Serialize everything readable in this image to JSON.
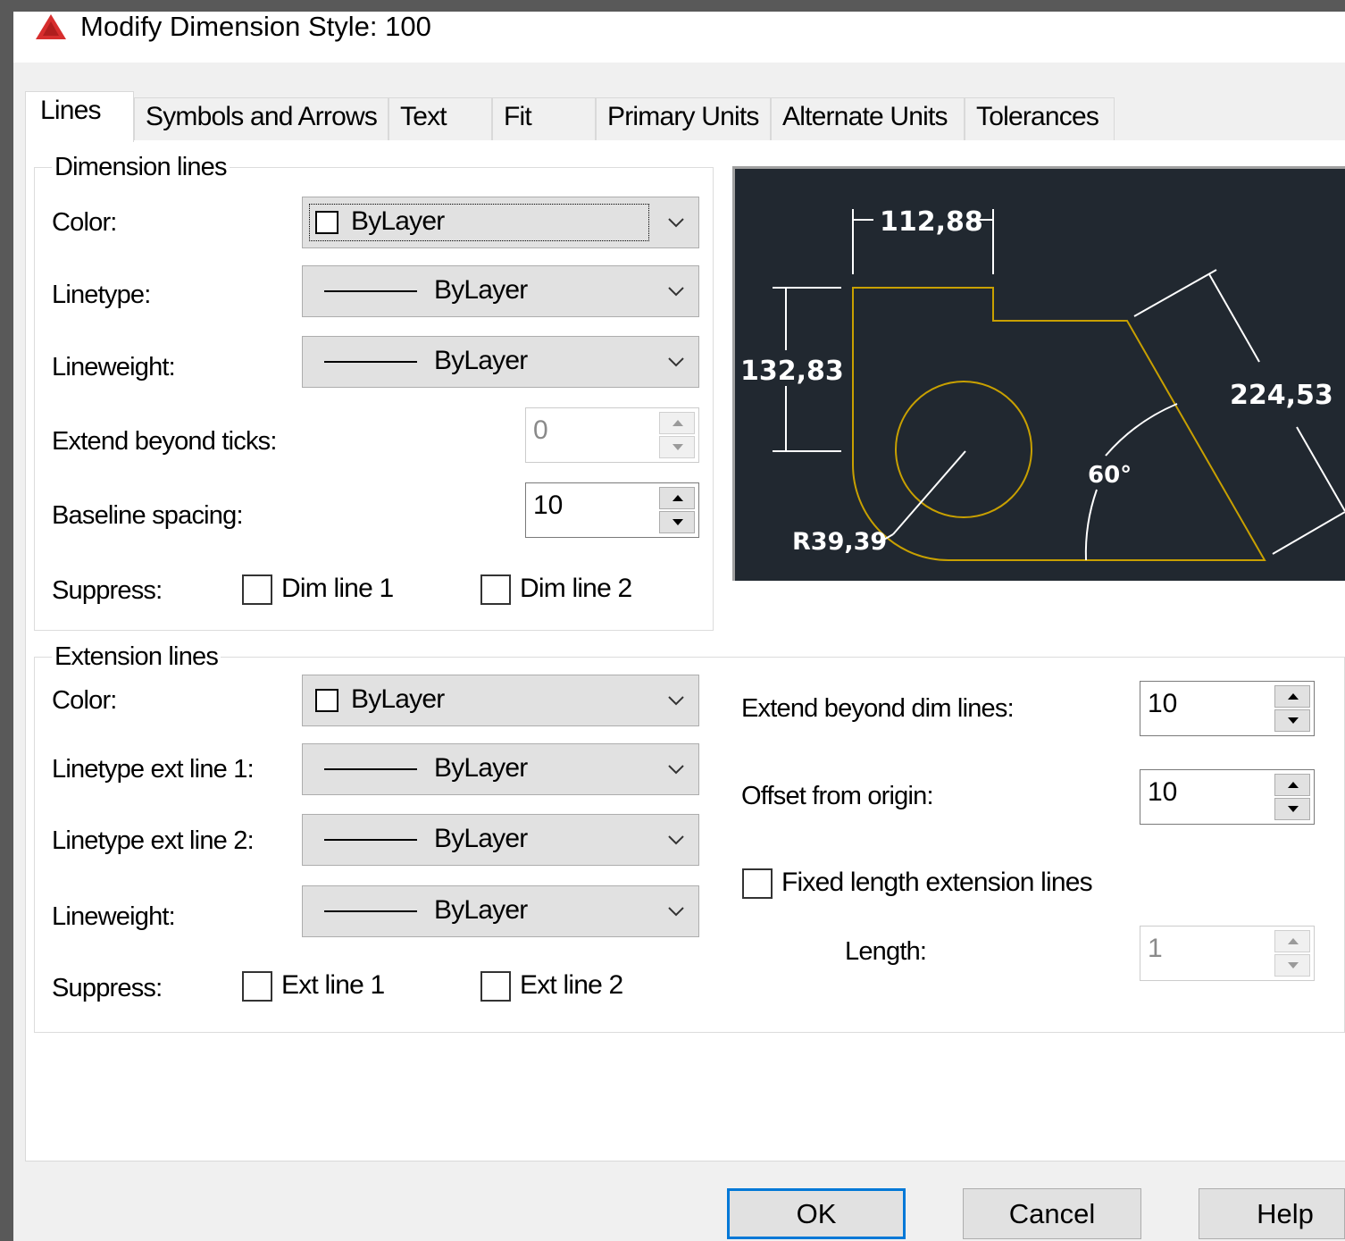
{
  "window": {
    "title": "Modify Dimension Style: 100"
  },
  "tabs": [
    {
      "label": "Lines",
      "active": true
    },
    {
      "label": "Symbols and Arrows"
    },
    {
      "label": "Text"
    },
    {
      "label": "Fit"
    },
    {
      "label": "Primary Units"
    },
    {
      "label": "Alternate Units"
    },
    {
      "label": "Tolerances"
    }
  ],
  "dimension_lines": {
    "title": "Dimension lines",
    "color_label": "Color:",
    "color_value": "ByLayer",
    "linetype_label": "Linetype:",
    "linetype_value": "ByLayer",
    "lineweight_label": "Lineweight:",
    "lineweight_value": "ByLayer",
    "extend_label": "Extend beyond ticks:",
    "extend_value": "0",
    "baseline_label": "Baseline spacing:",
    "baseline_value": "10",
    "suppress_label": "Suppress:",
    "dim_line1_label": "Dim line 1",
    "dim_line2_label": "Dim line 2"
  },
  "extension_lines": {
    "title": "Extension lines",
    "color_label": "Color:",
    "color_value": "ByLayer",
    "lt1_label": "Linetype ext line 1:",
    "lt1_value": "ByLayer",
    "lt2_label": "Linetype ext line 2:",
    "lt2_value": "ByLayer",
    "lineweight_label": "Lineweight:",
    "lineweight_value": "ByLayer",
    "suppress_label": "Suppress:",
    "ext_line1_label": "Ext line 1",
    "ext_line2_label": "Ext line 2",
    "extend_dim_label": "Extend beyond dim lines:",
    "extend_dim_value": "10",
    "offset_label": "Offset from origin:",
    "offset_value": "10",
    "fixed_length_label": "Fixed length extension lines",
    "length_label": "Length:",
    "length_value": "1"
  },
  "preview": {
    "dim_top": "112,88",
    "dim_left": "132,83",
    "dim_right": "224,53",
    "dim_angle": "60°",
    "dim_radius": "R39,39",
    "colors": {
      "background": "#212830",
      "geometry": "#c8a000",
      "dims": "#ffffff"
    }
  },
  "buttons": {
    "ok": "OK",
    "cancel": "Cancel",
    "help": "Help"
  },
  "colors": {
    "accent": "#0078d7",
    "app_icon": "#d72e2e"
  }
}
